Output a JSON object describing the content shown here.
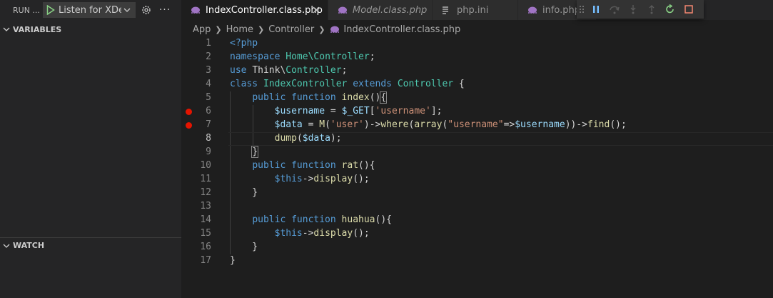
{
  "sidebar": {
    "run_title": "RUN ...",
    "config_label": "Listen for XDe",
    "variables_label": "VARIABLES",
    "watch_label": "WATCH"
  },
  "tabs": [
    {
      "label": "IndexController.class.php",
      "active": true
    },
    {
      "label": "Model.class.php",
      "active": false
    },
    {
      "label": "php.ini",
      "active": false
    },
    {
      "label": "info.php",
      "active": false
    }
  ],
  "breadcrumb": [
    "App",
    "Home",
    "Controller",
    "IndexController.class.php"
  ],
  "editor": {
    "breakpoint_lines": [
      6,
      7
    ],
    "current_line": 8,
    "lines": [
      [
        [
          "k",
          "<?php"
        ]
      ],
      [
        [
          "k",
          "namespace "
        ],
        [
          "c",
          "Home\\Controller"
        ],
        [
          "t",
          ";"
        ]
      ],
      [
        [
          "k",
          "use "
        ],
        [
          "t",
          "Think\\"
        ],
        [
          "c",
          "Controller"
        ],
        [
          "t",
          ";"
        ]
      ],
      [
        [
          "k",
          "class "
        ],
        [
          "c",
          "IndexController "
        ],
        [
          "k",
          "extends "
        ],
        [
          "c",
          "Controller "
        ],
        [
          "t",
          "{"
        ]
      ],
      [
        [
          "t",
          "    "
        ],
        [
          "k",
          "public function "
        ],
        [
          "f",
          "index"
        ],
        [
          "t",
          "()"
        ],
        [
          "br",
          "{"
        ]
      ],
      [
        [
          "t",
          "        "
        ],
        [
          "v",
          "$username"
        ],
        [
          "t",
          " = "
        ],
        [
          "v",
          "$_GET"
        ],
        [
          "t",
          "["
        ],
        [
          "s",
          "'username'"
        ],
        [
          "t",
          "];"
        ]
      ],
      [
        [
          "t",
          "        "
        ],
        [
          "v",
          "$data"
        ],
        [
          "t",
          " = "
        ],
        [
          "f",
          "M"
        ],
        [
          "t",
          "("
        ],
        [
          "s",
          "'user'"
        ],
        [
          "t",
          ")->"
        ],
        [
          "f",
          "where"
        ],
        [
          "t",
          "("
        ],
        [
          "f",
          "array"
        ],
        [
          "t",
          "("
        ],
        [
          "s",
          "\"username\""
        ],
        [
          "t",
          "=>"
        ],
        [
          "v",
          "$username"
        ],
        [
          "t",
          "))->"
        ],
        [
          "f",
          "find"
        ],
        [
          "t",
          "();"
        ]
      ],
      [
        [
          "t",
          "        "
        ],
        [
          "f",
          "dump"
        ],
        [
          "t",
          "("
        ],
        [
          "v",
          "$data"
        ],
        [
          "t",
          ");"
        ]
      ],
      [
        [
          "t",
          "    "
        ],
        [
          "br",
          "}"
        ]
      ],
      [
        [
          "t",
          "    "
        ],
        [
          "k",
          "public function "
        ],
        [
          "f",
          "rat"
        ],
        [
          "t",
          "(){"
        ]
      ],
      [
        [
          "t",
          "        "
        ],
        [
          "k",
          "$this"
        ],
        [
          "t",
          "->"
        ],
        [
          "f",
          "display"
        ],
        [
          "t",
          "();"
        ]
      ],
      [
        [
          "t",
          "    }"
        ]
      ],
      [
        [
          "t",
          ""
        ]
      ],
      [
        [
          "t",
          "    "
        ],
        [
          "k",
          "public function "
        ],
        [
          "f",
          "huahua"
        ],
        [
          "t",
          "(){"
        ]
      ],
      [
        [
          "t",
          "        "
        ],
        [
          "k",
          "$this"
        ],
        [
          "t",
          "->"
        ],
        [
          "f",
          "display"
        ],
        [
          "t",
          "();"
        ]
      ],
      [
        [
          "t",
          "    }"
        ]
      ],
      [
        [
          "t",
          "}"
        ]
      ]
    ]
  },
  "colors": {
    "breakpoint": "#e51400",
    "php_icon": "#a074c4",
    "continue_green": "#89d185",
    "stop_red": "#f48771",
    "pause_blue": "#75beff"
  }
}
